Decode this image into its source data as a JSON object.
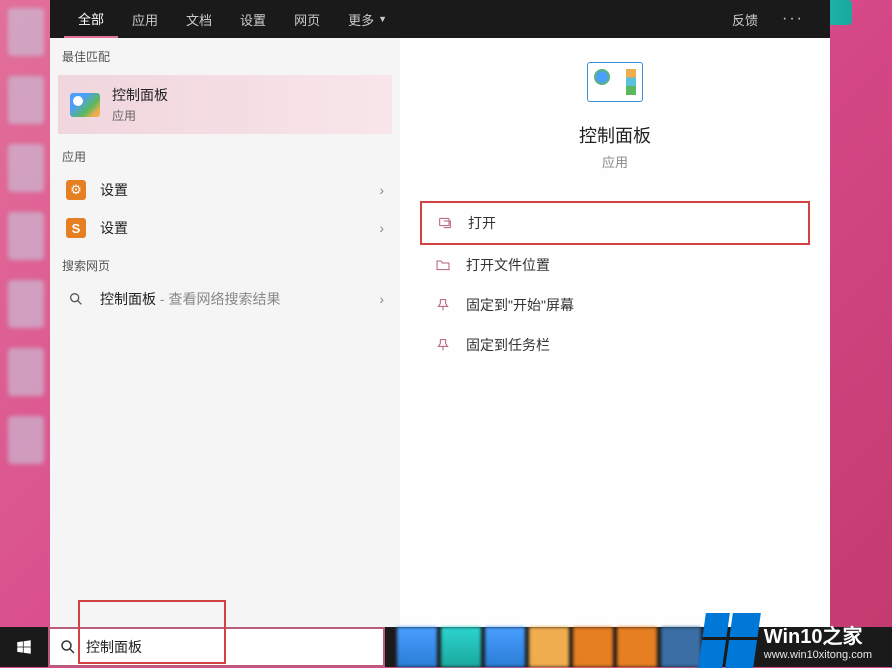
{
  "tabs": {
    "all": "全部",
    "apps": "应用",
    "docs": "文档",
    "settings": "设置",
    "web": "网页",
    "more": "更多",
    "feedback": "反馈"
  },
  "sections": {
    "best_match": "最佳匹配",
    "apps": "应用",
    "search_web": "搜索网页"
  },
  "best_match": {
    "title": "控制面板",
    "subtitle": "应用"
  },
  "app_items": [
    {
      "label": "设置",
      "icon": "gear"
    },
    {
      "label": "设置",
      "icon": "s"
    }
  ],
  "web_item": {
    "term": "控制面板",
    "suffix": " - 查看网络搜索结果"
  },
  "right": {
    "title": "控制面板",
    "subtitle": "应用",
    "actions": [
      {
        "label": "打开",
        "icon": "open"
      },
      {
        "label": "打开文件位置",
        "icon": "folder"
      },
      {
        "label": "固定到\"开始\"屏幕",
        "icon": "pin"
      },
      {
        "label": "固定到任务栏",
        "icon": "pin"
      }
    ]
  },
  "search": {
    "value": "控制面板",
    "cursor": "|"
  },
  "watermark": {
    "title": "Win10之家",
    "url": "www.win10xitong.com"
  }
}
